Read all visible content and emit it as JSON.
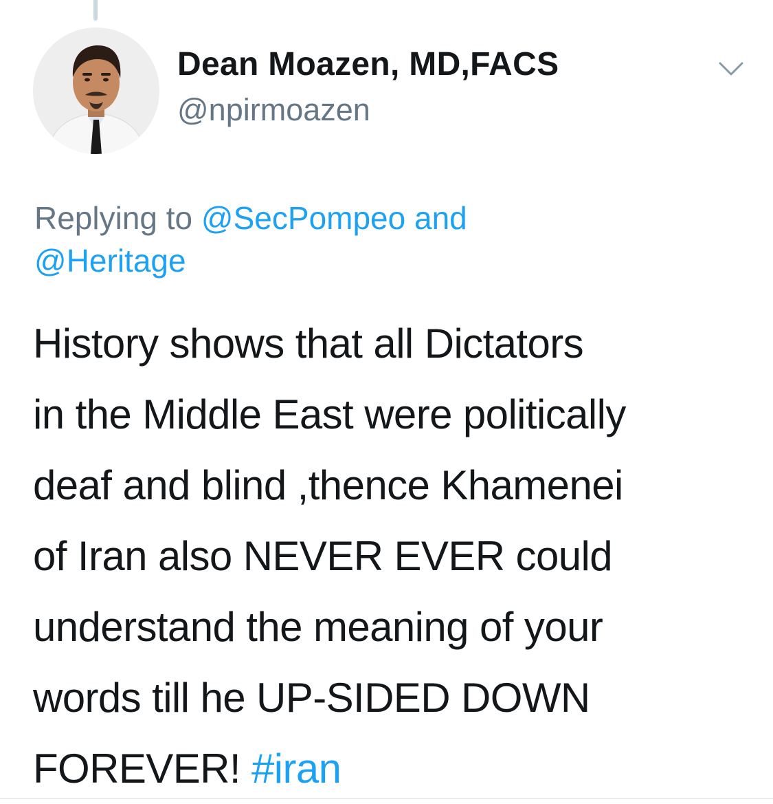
{
  "author": {
    "display_name": "Dean Moazen, MD,FACS",
    "handle": "@npirmoazen"
  },
  "reply_context": {
    "prefix": "Replying to",
    "mention_1": "@SecPompeo",
    "conjunction": "and",
    "mention_2": "@Heritage"
  },
  "tweet": {
    "lines": [
      "History shows that all Dictators",
      "in the Middle East were politically",
      "deaf and blind ,thence Khamenei",
      "of Iran also NEVER EVER could",
      "understand the meaning of your",
      "words till he UP-SIDED DOWN"
    ],
    "last_line_text": "FOREVER!",
    "hashtag": "#iran"
  },
  "icons": {
    "menu": "chevron-down-icon",
    "avatar": "profile-photo"
  },
  "colors": {
    "link": "#1da1f2",
    "secondary_text": "#657786",
    "primary_text": "#14171a",
    "thread_line": "#ccd6dd"
  }
}
